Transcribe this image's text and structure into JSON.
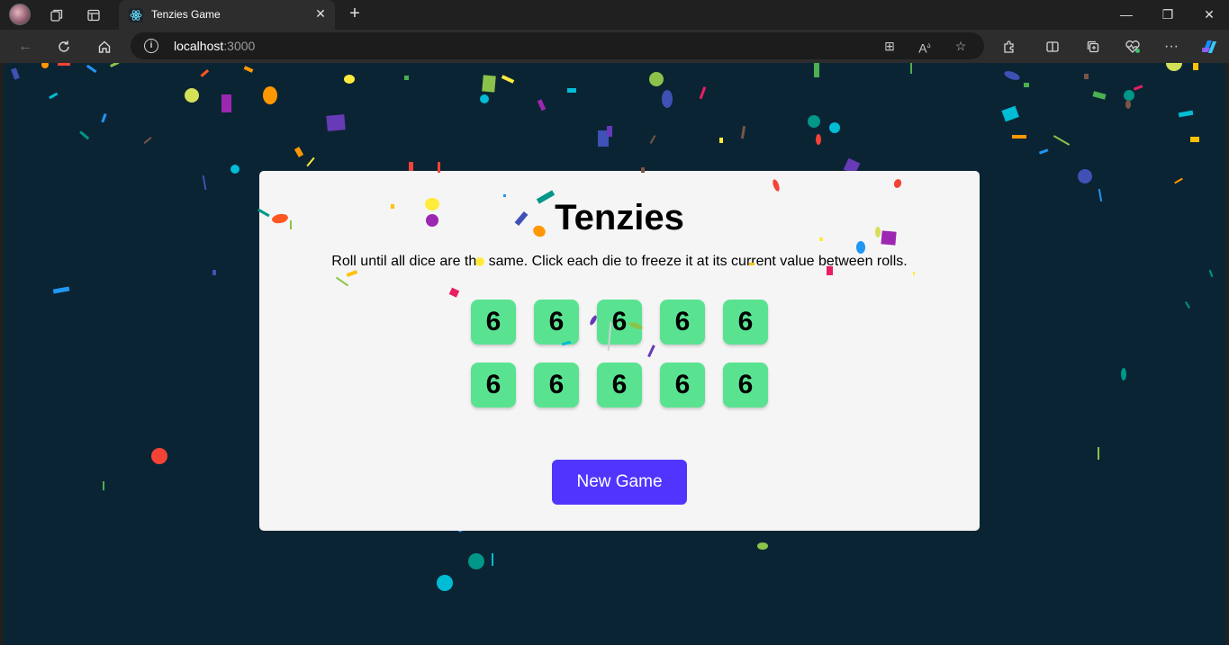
{
  "browser": {
    "tab_title": "Tenzies Game",
    "url_host": "localhost",
    "url_port": ":3000"
  },
  "game": {
    "title": "Tenzies",
    "instructions": "Roll until all dice are the same. Click each die to freeze it at its current value between rolls.",
    "dice": [
      "6",
      "6",
      "6",
      "6",
      "6",
      "6",
      "6",
      "6",
      "6",
      "6"
    ],
    "button_label": "New Game"
  },
  "colors": {
    "background": "#0b2434",
    "die": "#59e391",
    "button": "#5035ff"
  },
  "icons": {
    "tab_actions": "workspaces-icon",
    "tab_vertical": "vertical-tabs-icon",
    "favicon": "react-icon"
  }
}
